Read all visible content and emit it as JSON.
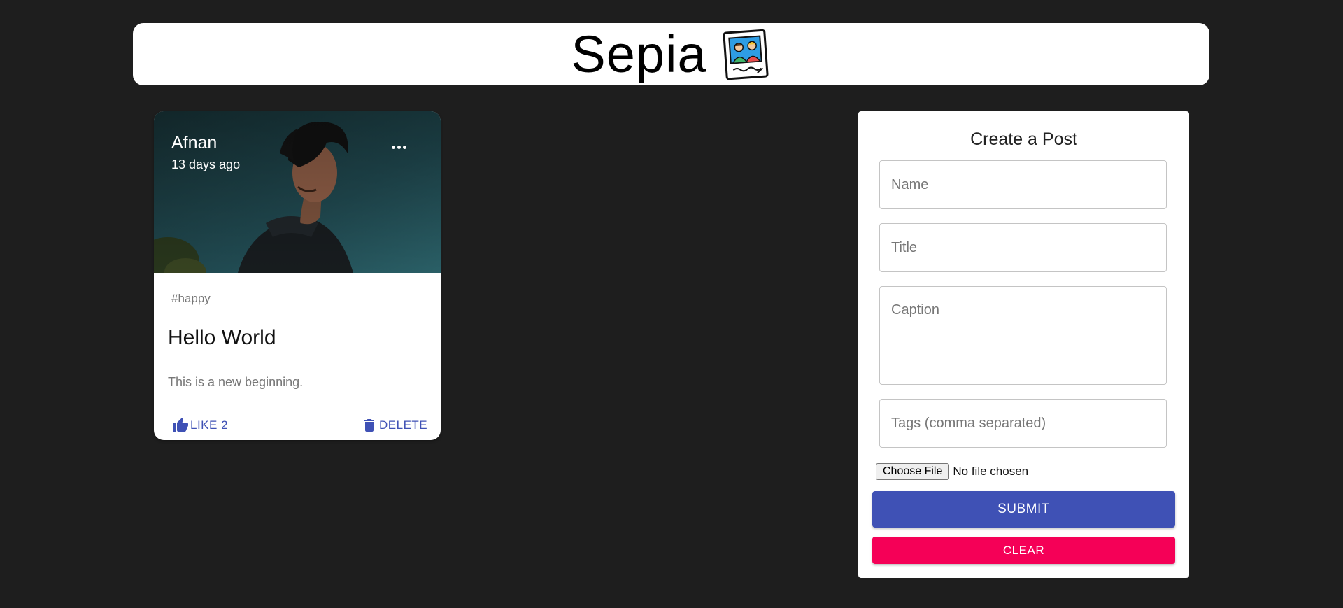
{
  "header": {
    "brand": "Sepia",
    "logo_icon": "photo-frame-logo"
  },
  "post": {
    "author": "Afnan",
    "time_ago": "13 days ago",
    "tags": "#happy",
    "title": "Hello World",
    "message": "This is a new beginning.",
    "like_label": "LIKE 2",
    "delete_label": "DELETE",
    "more_icon": "more-horizontal-icon",
    "like_icon": "thumb-up-icon",
    "delete_icon": "trash-icon",
    "image": "profile-photo-man-outdoors"
  },
  "form": {
    "heading": "Create a Post",
    "name_placeholder": "Name",
    "title_placeholder": "Title",
    "caption_placeholder": "Caption",
    "tags_placeholder": "Tags (comma separated)",
    "file_button": "Choose File",
    "file_status": "No file chosen",
    "submit_label": "SUBMIT",
    "clear_label": "CLEAR"
  },
  "colors": {
    "background": "#1e1e1e",
    "primary": "#3f51b5",
    "secondary": "#f50057"
  }
}
